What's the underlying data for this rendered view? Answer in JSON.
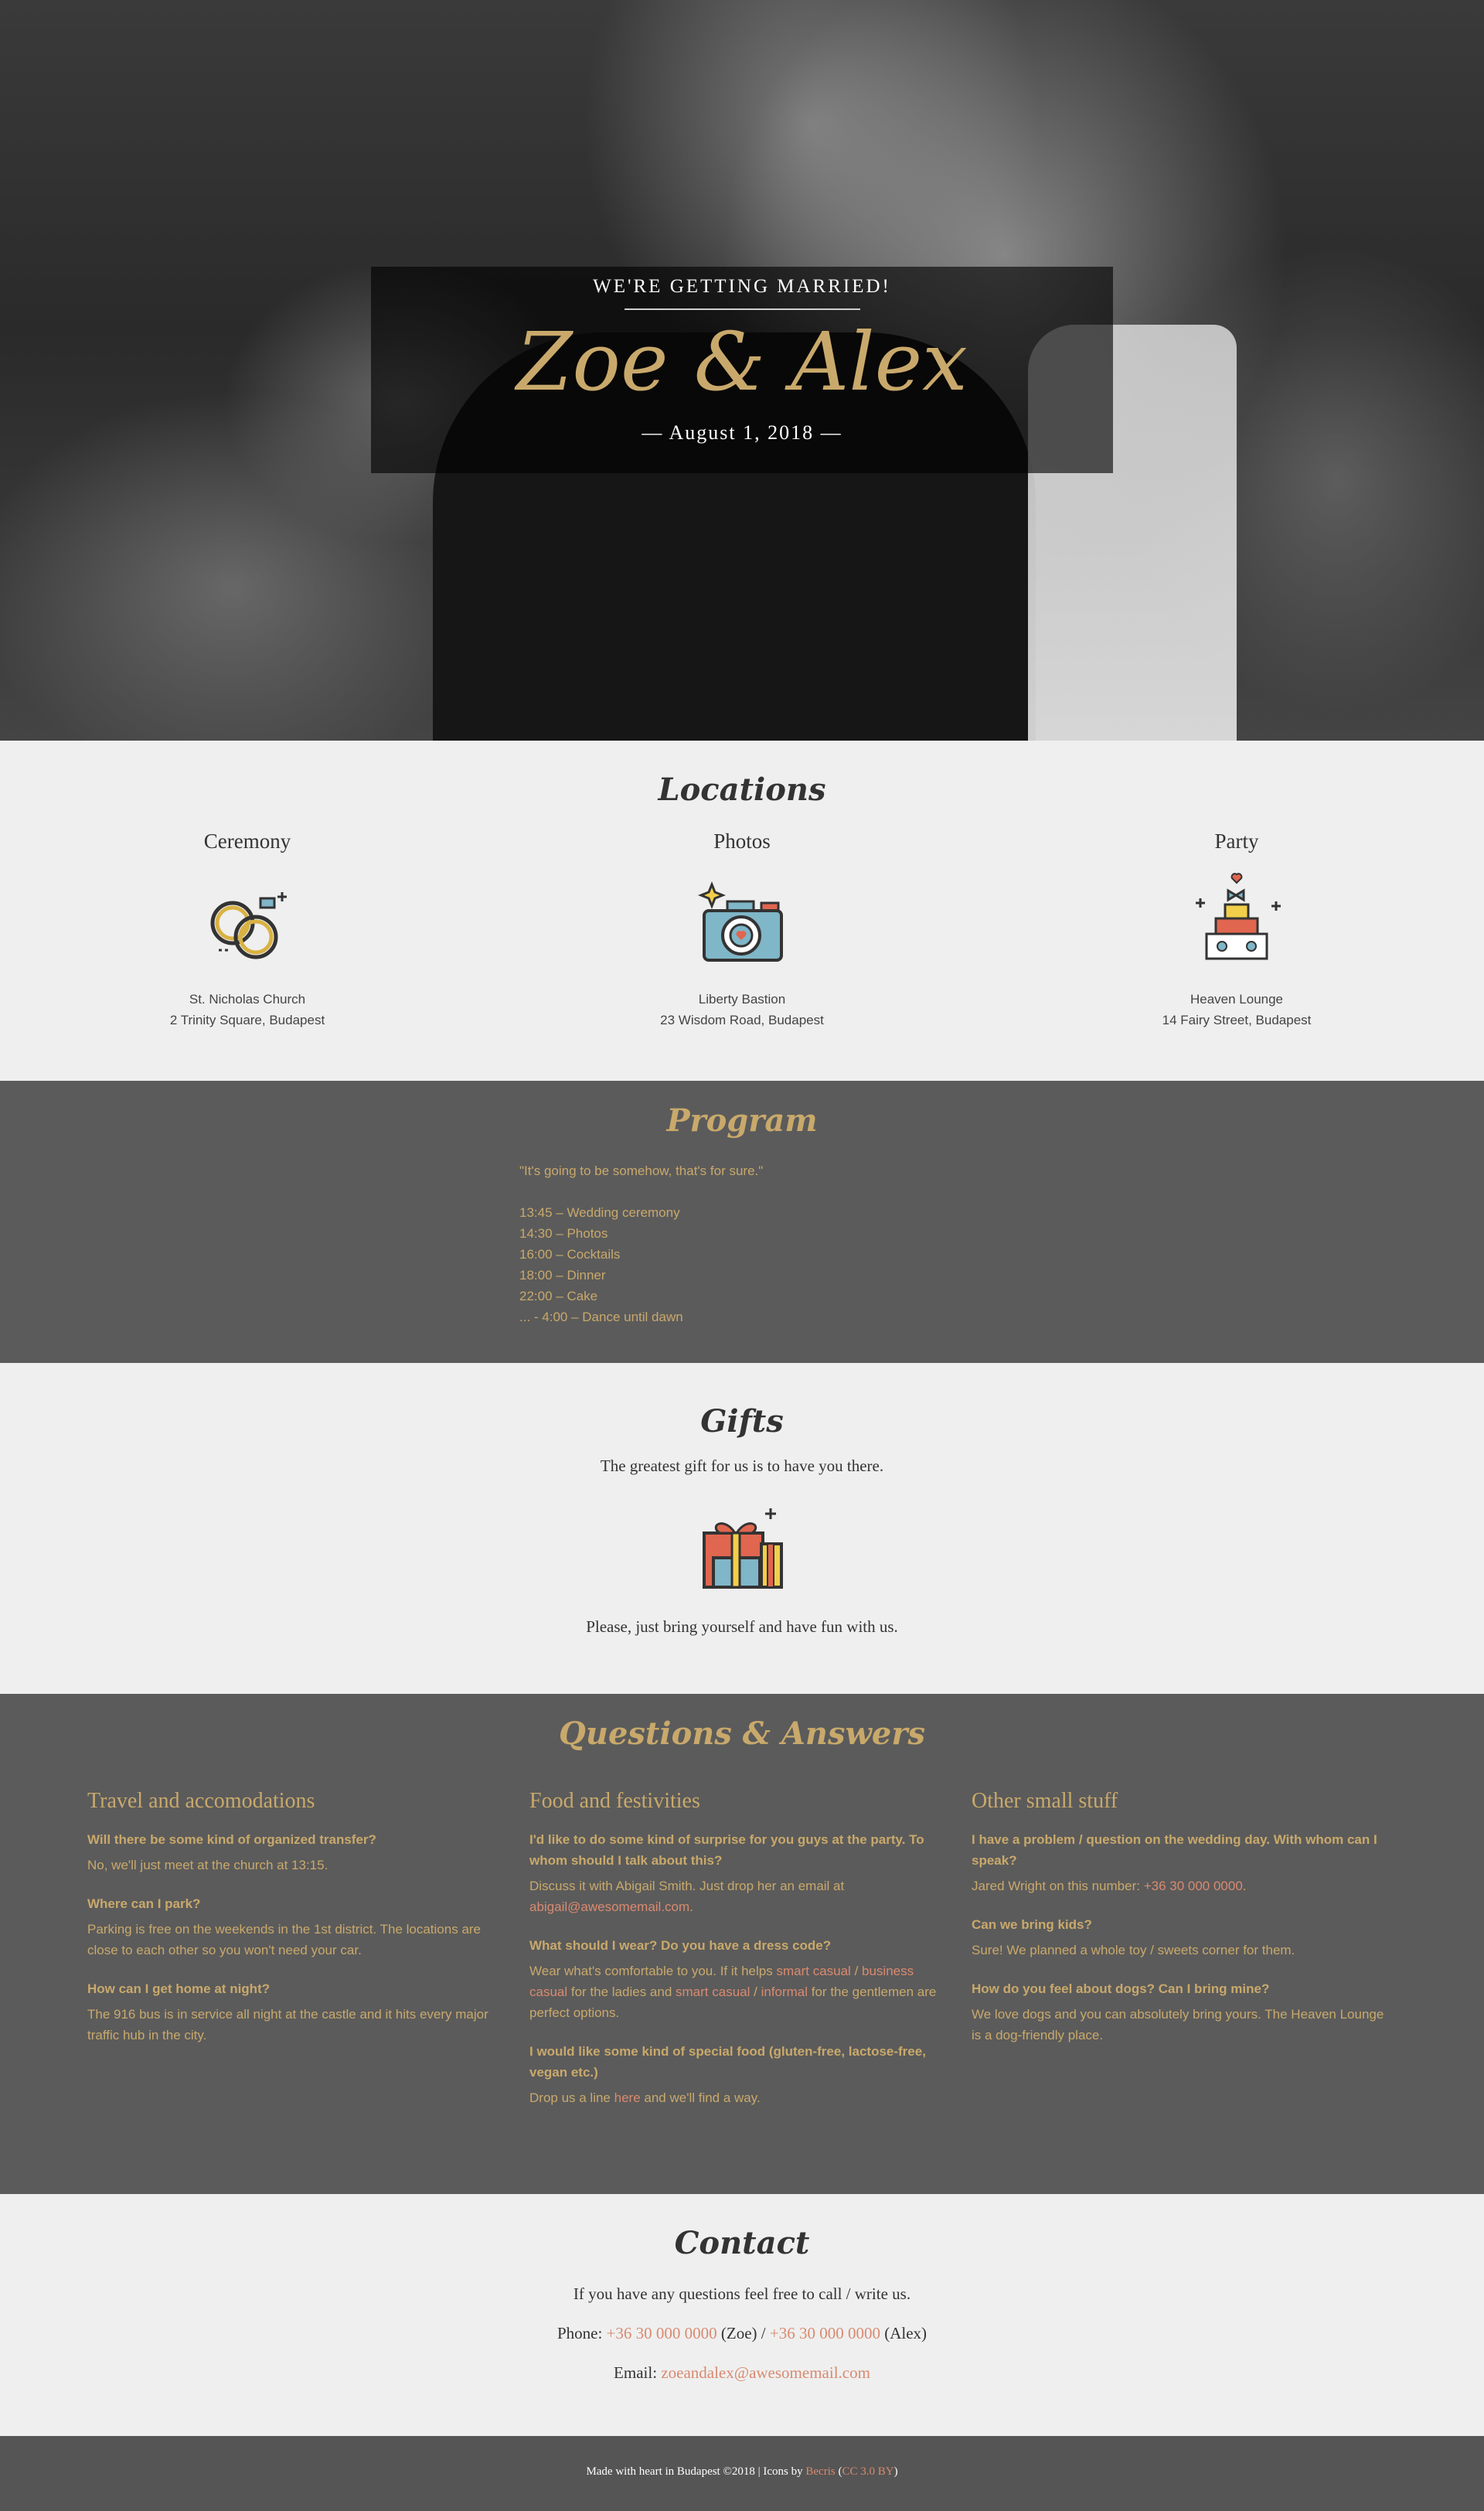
{
  "hero": {
    "subtitle": "WE'RE GETTING MARRIED!",
    "names": "Zoe & Alex",
    "date": "— August 1, 2018 —"
  },
  "locations": {
    "title": "Locations",
    "items": [
      {
        "heading": "Ceremony",
        "place": "St. Nicholas Church",
        "address": "2 Trinity Square, Budapest",
        "icon": "wedding-rings-icon"
      },
      {
        "heading": "Photos",
        "place": "Liberty Bastion",
        "address": "23 Wisdom Road, Budapest",
        "icon": "camera-icon"
      },
      {
        "heading": "Party",
        "place": "Heaven Lounge",
        "address": "14 Fairy Street, Budapest",
        "icon": "wedding-cake-icon"
      }
    ]
  },
  "program": {
    "title": "Program",
    "quote": "\"It's going to be somehow, that's for sure.\"",
    "items": [
      "13:45 – Wedding ceremony",
      "14:30 – Photos",
      "16:00 – Cocktails",
      "18:00 – Dinner",
      "22:00 – Cake",
      "... - 4:00 – Dance until dawn"
    ]
  },
  "gifts": {
    "title": "Gifts",
    "text1": "The greatest gift for us is to have you there.",
    "text2": "Please, just bring yourself and have fun with us.",
    "icon": "gift-boxes-icon"
  },
  "qa": {
    "title": "Questions & Answers",
    "columns": [
      {
        "heading": "Travel and accomodations",
        "items": [
          {
            "q": "Will there be some kind of organized transfer?",
            "a": "No, we'll just meet at the church at 13:15."
          },
          {
            "q": "Where can I park?",
            "a": "Parking is free on the weekends in the 1st district. The locations are close to each other so you won't need your car."
          },
          {
            "q": "How can I get home at night?",
            "a": "The 916 bus is in service all night at the castle and it hits every major traffic hub in the city."
          }
        ]
      },
      {
        "heading": "Food and festivities",
        "items": [
          {
            "q": "I'd like to do some kind of surprise for you guys at the party. To whom should I talk about this?",
            "a1": "Discuss it with Abigail Smith. Just drop her an email at ",
            "link": "abigail@awesomemail.com",
            "a2": "."
          },
          {
            "q": "What should I wear? Do you have a dress code?",
            "a1": "Wear what's comfortable to you. If it helps ",
            "link1": "smart casual",
            "sep1": " / ",
            "link2": "business casual",
            "a2": " for the ladies and ",
            "link3": "smart casual",
            "sep2": " / ",
            "link4": "informal",
            "a3": " for the gentlemen are perfect options."
          },
          {
            "q": "I would like some kind of special food (gluten-free, lactose-free, vegan etc.)",
            "a1": "Drop us a line ",
            "link": "here",
            "a2": " and we'll find a way."
          }
        ]
      },
      {
        "heading": "Other small stuff",
        "items": [
          {
            "q": "I have a problem / question on the wedding day. With whom can I speak?",
            "a1": "Jared Wright on this number: ",
            "link": "+36 30 000 0000",
            "a2": "."
          },
          {
            "q": "Can we bring kids?",
            "a": "Sure! We planned a whole toy / sweets corner for them."
          },
          {
            "q": "How do you feel about dogs? Can I bring mine?",
            "a": "We love dogs and you can absolutely bring yours. The Heaven Lounge is a dog-friendly place."
          }
        ]
      }
    ]
  },
  "contact": {
    "title": "Contact",
    "intro": "If you have any questions feel free to call / write us.",
    "phone_label": "Phone: ",
    "phone1": "+36 30 000 0000",
    "phone1_who": " (Zoe) / ",
    "phone2": "+36 30 000 0000",
    "phone2_who": " (Alex)",
    "email_label": "Email: ",
    "email": "zoeandalex@awesomemail.com"
  },
  "footer": {
    "text": "Made with heart in Budapest ©2018 | Icons by ",
    "icons_author": "Becris",
    "paren_open": " (",
    "license": "CC 3.0 BY",
    "paren_close": ")"
  },
  "colors": {
    "gold": "#c9a96b",
    "link": "#d98a6f",
    "dark_bg": "#5b5b5b",
    "light_bg": "#efefef"
  }
}
